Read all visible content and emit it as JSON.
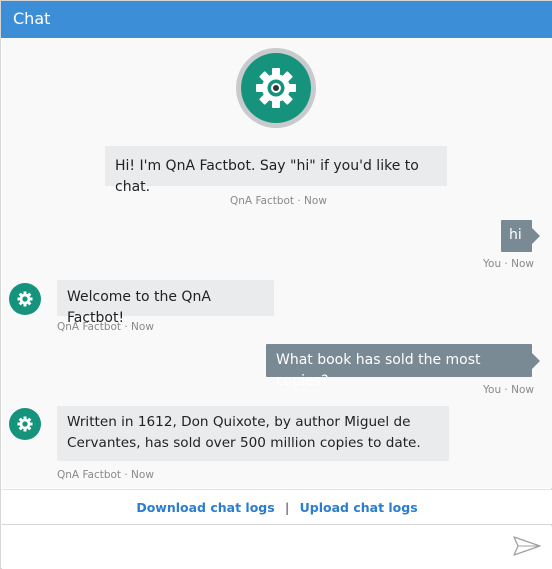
{
  "header": {
    "title": "Chat"
  },
  "messages": [
    {
      "from": "bot",
      "text": "Hi! I'm QnA Factbot. Say \"hi\" if you'd like to chat.",
      "meta": "QnA Factbot · Now"
    },
    {
      "from": "user",
      "text": "hi",
      "meta": "You · Now"
    },
    {
      "from": "bot",
      "text": "Welcome to the QnA Factbot!",
      "meta": "QnA Factbot · Now"
    },
    {
      "from": "user",
      "text": "What book has sold the most copies?",
      "meta": "You · Now"
    },
    {
      "from": "bot",
      "text_line1": "Written in 1612, Don Quixote, by author Miguel de",
      "text_line2": "Cervantes, has sold over 500 million copies to date.",
      "meta": "QnA Factbot · Now"
    }
  ],
  "logs": {
    "download_label": "Download chat logs",
    "separator": "|",
    "upload_label": "Upload chat logs"
  },
  "input": {
    "placeholder": "",
    "value": ""
  },
  "icons": {
    "bot_avatar": "gear-icon",
    "send": "send-icon"
  },
  "colors": {
    "header": "#3c8fd6",
    "bot_avatar": "#15937d",
    "user_bubble": "#7a8a94",
    "bot_bubble": "#e9ebed",
    "link": "#2c7ccf"
  }
}
